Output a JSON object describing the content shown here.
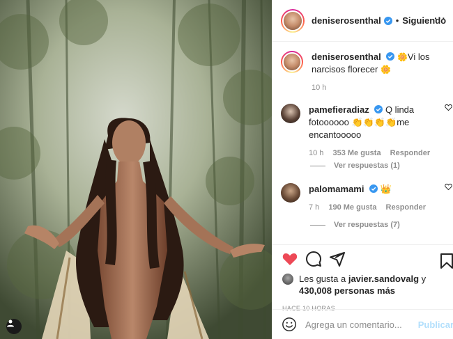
{
  "post": {
    "author": "deniserosenthal",
    "follow_status": "Siguiendo",
    "dot": "•",
    "caption": {
      "username": "deniserosenthal",
      "text_before": "",
      "text": "Vi los narcisos florecer",
      "time": "10 h"
    },
    "comments": [
      {
        "username": "pamefieradiaz",
        "text": "Q linda fotoooooo 👏👏👏👏me encantooooo",
        "time": "10 h",
        "likes": "353 Me gusta",
        "reply": "Responder",
        "view_replies": "Ver respuestas (1)"
      },
      {
        "username": "palomamami",
        "text": "👑",
        "time": "7 h",
        "likes": "190 Me gusta",
        "reply": "Responder",
        "view_replies": "Ver respuestas (7)"
      }
    ],
    "likes_line_prefix": "Les gusta a",
    "liked_by": "javier.sandovalg",
    "likes_and": "y",
    "likes_count": "430,008 personas más",
    "posted_ago": "HACE 10 HORAS",
    "comment_placeholder": "Agrega un comentario...",
    "publish_label": "Publicar"
  },
  "icons": {
    "verified": "verified-badge-icon",
    "heart": "heart-icon",
    "comment": "comment-icon",
    "share": "share-icon",
    "bookmark": "bookmark-icon",
    "emoji": "smile-icon",
    "user_tag": "user-tag-icon"
  },
  "colors": {
    "like_red": "#ed4956",
    "verified_blue": "#3897f0",
    "publish_disabled": "#b2dffc",
    "muted": "#8e8e8e"
  }
}
